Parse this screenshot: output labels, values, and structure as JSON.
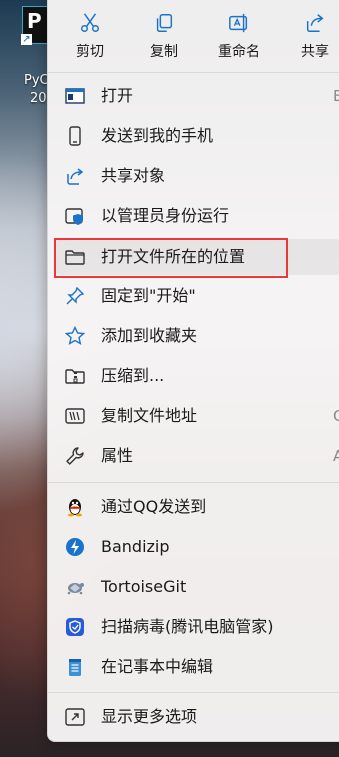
{
  "desktop": {
    "icon_label_line1": "PyC",
    "icon_label_line2": "20"
  },
  "toolbar": {
    "cut": "剪切",
    "copy": "复制",
    "rename": "重命名",
    "share": "共享"
  },
  "menu": {
    "open": {
      "label": "打开",
      "key": "E"
    },
    "send_phone": {
      "label": "发送到我的手机"
    },
    "share_obj": {
      "label": "共享对象"
    },
    "run_admin": {
      "label": "以管理员身份运行"
    },
    "open_location": {
      "label": "打开文件所在的位置"
    },
    "pin_start": {
      "label": "固定到\"开始\""
    },
    "add_favorites": {
      "label": "添加到收藏夹"
    },
    "compress": {
      "label": "压缩到..."
    },
    "copy_path": {
      "label": "复制文件地址",
      "key": "C"
    },
    "properties": {
      "label": "属性",
      "key": "A"
    },
    "qq_send": {
      "label": "通过QQ发送到"
    },
    "bandizip": {
      "label": "Bandizip"
    },
    "tortoisegit": {
      "label": "TortoiseGit"
    },
    "virus_scan": {
      "label": "扫描病毒(腾讯电脑管家)"
    },
    "notepad_edit": {
      "label": "在记事本中编辑"
    },
    "more_options": {
      "label": "显示更多选项"
    }
  },
  "colors": {
    "accent_blue": "#1a73c9",
    "highlight_box": "#e8383b"
  }
}
